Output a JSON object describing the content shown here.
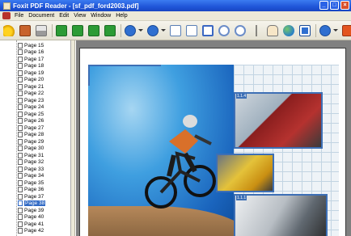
{
  "window": {
    "title": "Foxit PDF Reader - [sf_pdf_ford2003.pdf]",
    "controls": [
      "_",
      "□",
      "×"
    ]
  },
  "menu": {
    "items": [
      "File",
      "Document",
      "Edit",
      "View",
      "Window",
      "Help"
    ]
  },
  "toolbar": {
    "icons": [
      "open-icon",
      "save-icon",
      "print-icon",
      "first-page-icon",
      "previous-page-icon",
      "next-page-icon",
      "last-page-icon",
      "zoom-out-icon",
      "zoom-in-icon",
      "single-page-icon",
      "continuous-page-icon",
      "facing-page-icon",
      "rotate-left-icon",
      "rotate-right-icon",
      "text-select-icon",
      "hand-tool-icon",
      "globe-icon",
      "snapshot-icon",
      "help-icon",
      "close-doc-icon"
    ]
  },
  "sidebar": {
    "items": [
      "Page 15",
      "Page 16",
      "Page 17",
      "Page 18",
      "Page 19",
      "Page 20",
      "Page 21",
      "Page 22",
      "Page 23",
      "Page 24",
      "Page 25",
      "Page 26",
      "Page 27",
      "Page 28",
      "Page 29",
      "Page 30",
      "Page 31",
      "Page 32",
      "Page 33",
      "Page 34",
      "Page 35",
      "Page 36",
      "Page 37",
      "Page 38",
      "Page 39",
      "Page 40",
      "Page 41",
      "Page 42"
    ],
    "selected": "Page 38"
  },
  "document": {
    "photo_labels": [
      "1.1.4",
      "1.1.1"
    ]
  }
}
